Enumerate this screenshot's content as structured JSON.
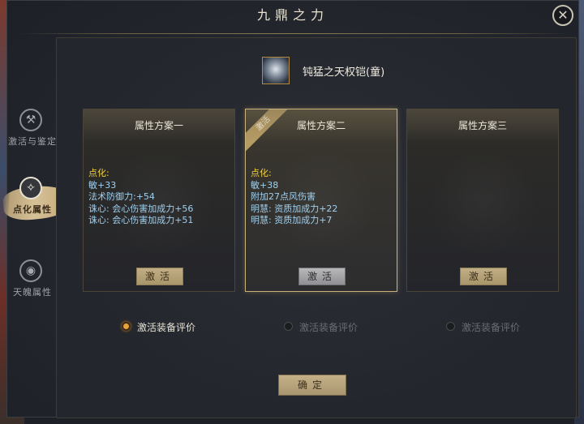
{
  "window": {
    "title": "九鼎之力"
  },
  "sidebar": {
    "tabs": [
      {
        "label": "激活与鉴定",
        "icon": "anvil-icon",
        "active": false
      },
      {
        "label": "点化属性",
        "icon": "flame-orb-icon",
        "active": true
      },
      {
        "label": "天魄属性",
        "icon": "spirit-orb-icon",
        "active": false
      }
    ]
  },
  "item": {
    "name": "钝猛之天权铠(童)"
  },
  "cards": [
    {
      "title": "属性方案一",
      "section": "点化:",
      "lines": [
        "敏+33",
        "法术防御力:+54",
        "诛心: 会心伤害加成力+56",
        "诛心: 会心伤害加成力+51"
      ],
      "button": "激活",
      "badge": ""
    },
    {
      "title": "属性方案二",
      "section": "点化:",
      "lines": [
        "敏+38",
        "附加27点风伤害",
        "明慧: 资质加成力+22",
        "明慧: 资质加成力+7"
      ],
      "button": "激活",
      "badge": "激活"
    },
    {
      "title": "属性方案三",
      "section": "",
      "lines": [],
      "button": "激活",
      "badge": ""
    }
  ],
  "radios": [
    {
      "label": "激活装备评价",
      "checked": true
    },
    {
      "label": "激活装备评价",
      "checked": false
    },
    {
      "label": "激活装备评价",
      "checked": false
    }
  ],
  "footer": {
    "confirm_label": "确定"
  },
  "colors": {
    "attribute_section": "#f4d23a",
    "attribute_text": "#9fd0f0",
    "accent_gold": "#c2ae84"
  }
}
